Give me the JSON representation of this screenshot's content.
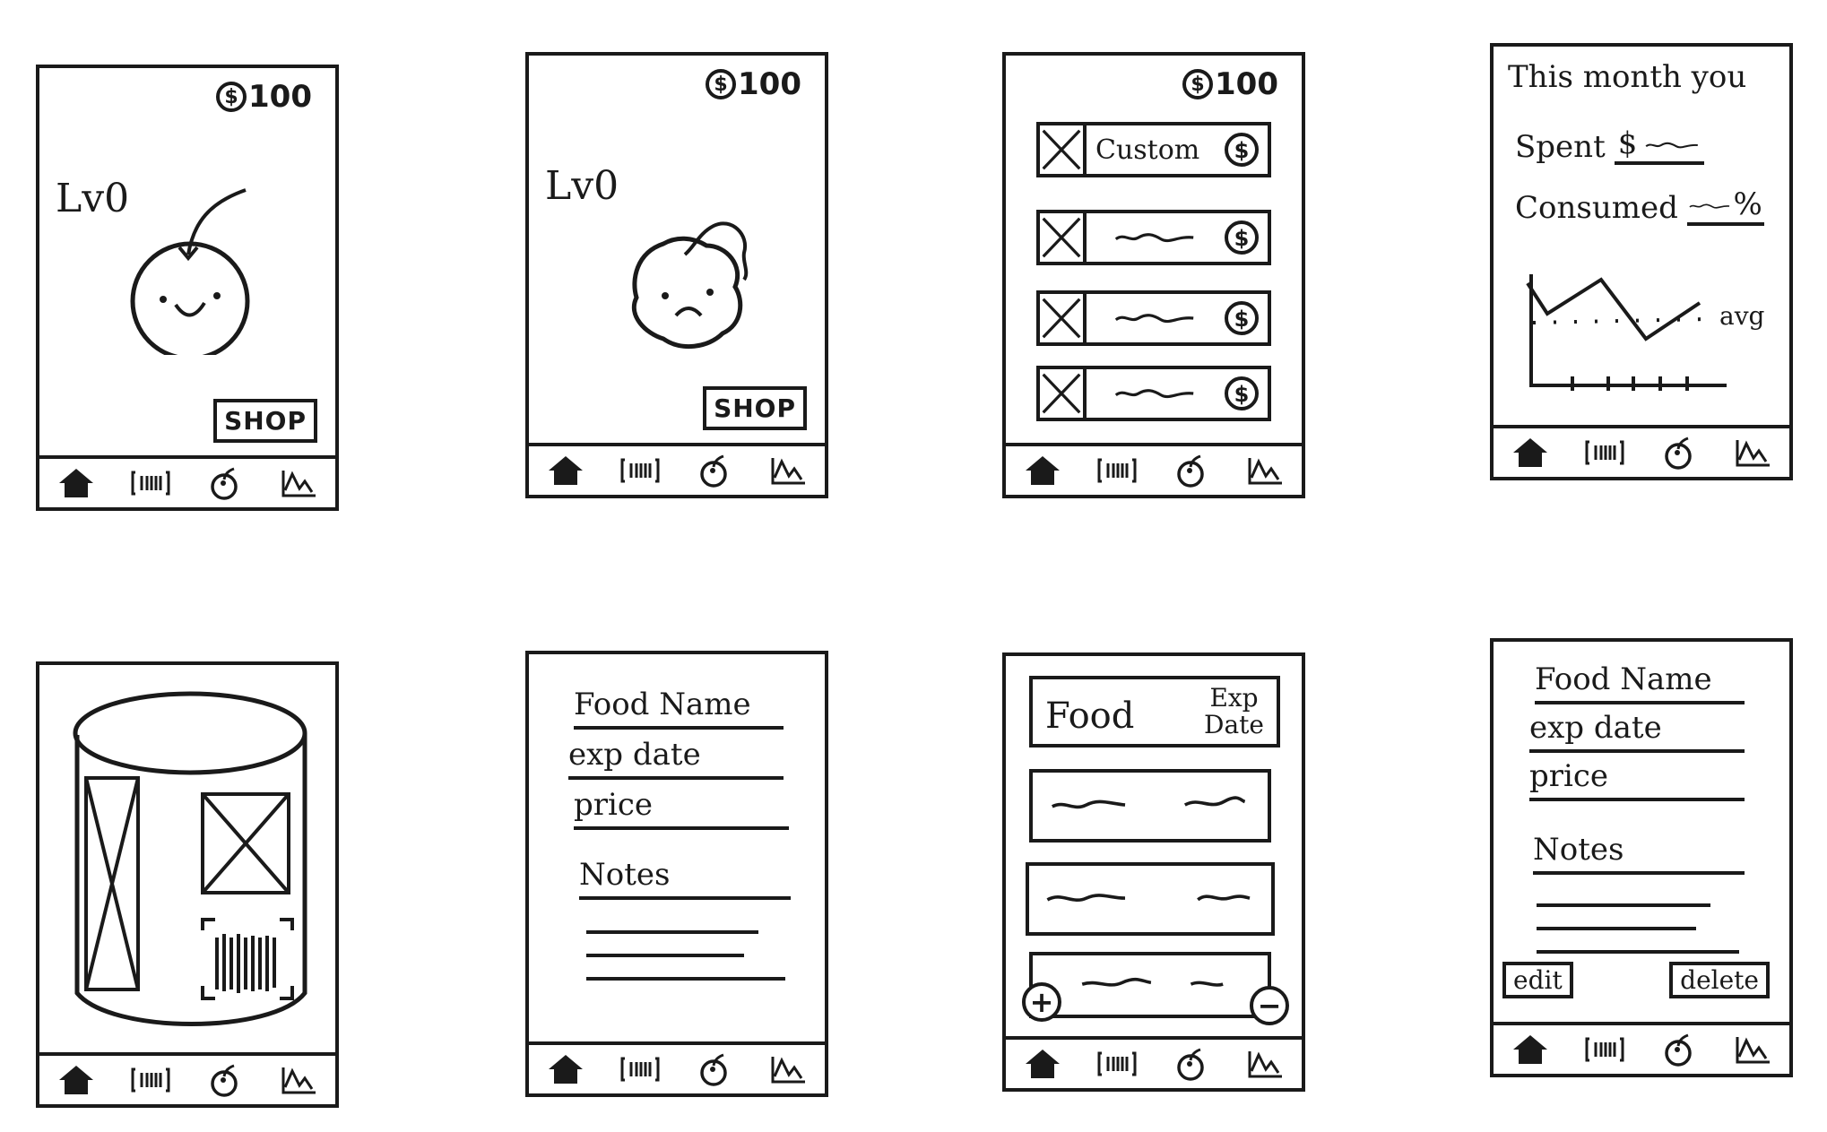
{
  "coins": {
    "amount": "100",
    "symbol": "$"
  },
  "pet": {
    "level": "Lv0",
    "shop_label": "SHOP",
    "happy_icon": "happy-apple-icon",
    "sad_icon": "sad-rotten-apple-icon"
  },
  "nav": [
    "home-icon",
    "barcode-icon",
    "apple-icon",
    "chart-icon"
  ],
  "shop": {
    "custom_label": "Custom"
  },
  "stats": {
    "title": "This month you",
    "spent_label": "Spent",
    "spent_prefix": "$",
    "consumed_label": "Consumed",
    "consumed_suffix": "%",
    "avg_label": "avg"
  },
  "form": {
    "food_name": "Food Name",
    "exp_date": "exp date",
    "price": "price",
    "notes": "Notes"
  },
  "list": {
    "col_food": "Food",
    "col_exp_line1": "Exp",
    "col_exp_line2": "Date",
    "add": "+",
    "remove": "−"
  },
  "detail": {
    "food_name": "Food Name",
    "exp_date": "exp date",
    "price": "price",
    "notes": "Notes",
    "edit": "edit",
    "delete": "delete"
  }
}
